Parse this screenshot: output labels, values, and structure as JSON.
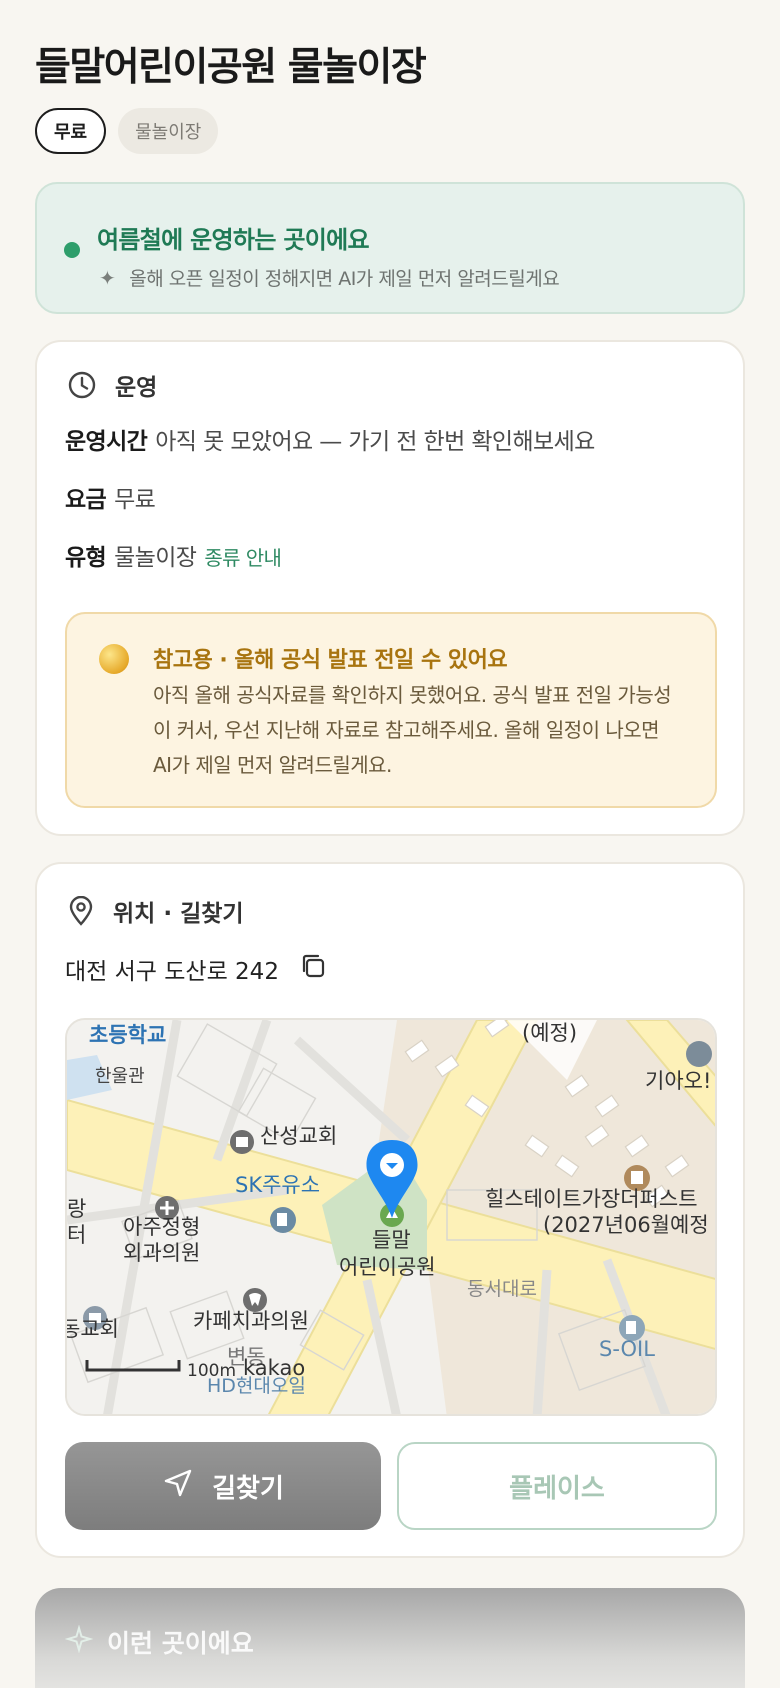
{
  "place": {
    "title": "들말어린이공원 물놀이장",
    "chips": {
      "fee": "무료",
      "kind": "물놀이장"
    }
  },
  "season_banner": {
    "heading": "여름철에 운영하는 곳이에요",
    "subtext": "올해 오픈 일정이 정해지면 AI가 제일 먼저 알려드릴게요"
  },
  "operation": {
    "section_title": "운영",
    "hours_label": "운영시간",
    "hours_value": "아직 못 모았어요 — 가기 전 한번 확인해보세요",
    "fee_label": "요금",
    "fee_value": "무료",
    "type_label": "유형",
    "type_value": "물놀이장",
    "type_link": "종류 안내",
    "notice_title": "참고용 · 올해 공식 발표 전일 수 있어요",
    "notice_body": "아직 올해 공식자료를 확인하지 못했어요. 공식 발표 전일 가능성이 커서, 우선 지난해 자료로 참고해주세요. 올해 일정이 나오면 AI가 제일 먼저 알려드릴게요."
  },
  "location": {
    "section_title": "위치 · 길찾기",
    "address": "대전 서구 도산로 242",
    "map": {
      "labels": {
        "school": "초등학교",
        "hanul": "한울관",
        "construction": "(예정)",
        "kia": "기아오!",
        "church": "산성교회",
        "sk": "SK주유소",
        "park_line1": "들말",
        "park_line2": "어린이공원",
        "hill_line1": "힐스테이트가장더퍼스트",
        "hill_line2": "(2027년06월예정",
        "lang1": "랑",
        "lang2": "터",
        "clinic_line1": "아주정형",
        "clinic_line2": "외과의원",
        "road": "동서대로",
        "dong_church": "동교회",
        "dental": "카페치과의원",
        "soil": "S-OIL",
        "byeon": "변동",
        "hd": "HD현대오일",
        "scale": "100m",
        "brand": "kakao"
      }
    },
    "route_button": "길찾기",
    "place_button": "플레이스"
  },
  "more_section": {
    "title": "이런 곳이에요"
  },
  "colors": {
    "accent_green": "#2e9e6b",
    "notice_amber": "#a8740f",
    "map_pin": "#1e88f0"
  }
}
